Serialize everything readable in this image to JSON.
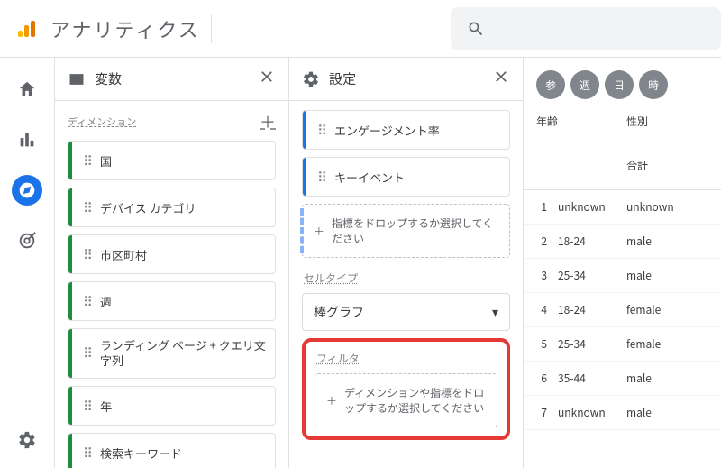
{
  "app_title": "アナリティクス",
  "panels": {
    "vars": {
      "title": "変数",
      "dim_label": "ディメンション",
      "dims": [
        "国",
        "デバイス カテゴリ",
        "市区町村",
        "週",
        "ランディング ページ + クエリ文字列",
        "年",
        "検索キーワード"
      ]
    },
    "settings": {
      "title": "設定",
      "metrics": [
        "エンゲージメント率",
        "キーイベント"
      ],
      "drop_metric": "指標をドロップするか選択してください",
      "celltype_label": "セルタイプ",
      "celltype_value": "棒グラフ",
      "filter_label": "フィルタ",
      "drop_filter": "ディメンションや指標をドロップするか選択してください"
    }
  },
  "pills": [
    "参",
    "週",
    "日",
    "時"
  ],
  "grid": {
    "col1": "年齢",
    "col2": "性別",
    "total": "合計",
    "rows": [
      {
        "n": "1",
        "a": "unknown",
        "b": "unknown"
      },
      {
        "n": "2",
        "a": "18-24",
        "b": "male"
      },
      {
        "n": "3",
        "a": "25-34",
        "b": "male"
      },
      {
        "n": "4",
        "a": "18-24",
        "b": "female"
      },
      {
        "n": "5",
        "a": "25-34",
        "b": "female"
      },
      {
        "n": "6",
        "a": "35-44",
        "b": "male"
      },
      {
        "n": "7",
        "a": "unknown",
        "b": "male"
      }
    ]
  }
}
